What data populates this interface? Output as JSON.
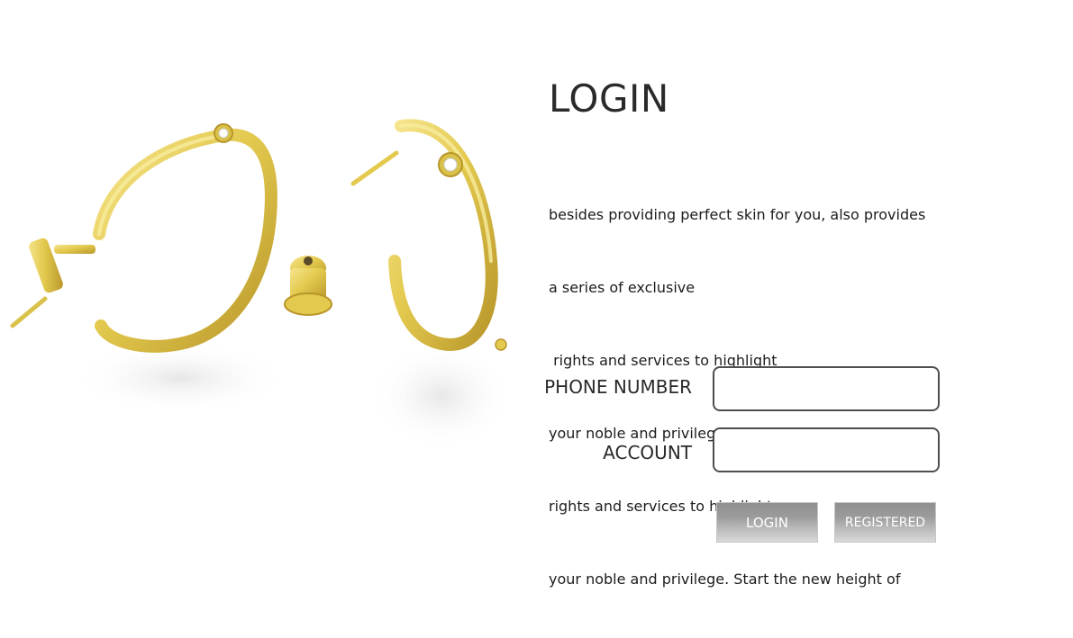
{
  "hero": {
    "image": "gold-hoop-earrings-icon",
    "gold": "#e3c94e",
    "gold_dark": "#b8962a",
    "gold_light": "#f6e58e"
  },
  "login": {
    "title": "LOGIN",
    "description_lines": [
      "besides providing perfect skin for you, also provides",
      "a series of exclusive",
      " rights and services to highlight",
      "your noble and privilege. Start the new height of",
      "rights and services to highlight",
      "your noble and privilege. Start the new height of"
    ],
    "phone_label": "PHONE NUMBER",
    "phone_value": "",
    "account_label": "ACCOUNT",
    "account_value": "",
    "login_button": "LOGIN",
    "register_button": "REGISTERED"
  },
  "colors": {
    "input_border": "#4e4e4e",
    "button_gradient_top": "#8f8f8f",
    "button_gradient_bottom": "#d9d9d9"
  }
}
